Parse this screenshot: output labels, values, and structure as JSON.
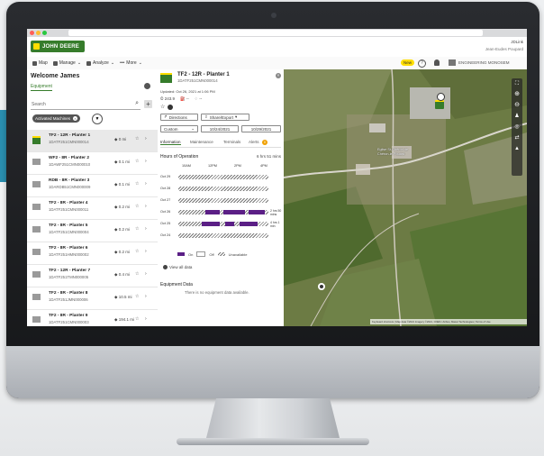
{
  "app": {
    "brand": "John Deere",
    "product": "JDLink",
    "user": "Jean-Eudes Poupard",
    "org": "ENGINEERING MONOSEM"
  },
  "nav": {
    "items": [
      "Map",
      "Manage",
      "Analyze",
      "More"
    ],
    "new_badge": "New"
  },
  "left_panel": {
    "welcome": "Welcome James",
    "tab": "Equipment",
    "search_placeholder": "Search",
    "filter_chip": "Activated Machines",
    "machines": [
      {
        "name": "TF2 - 12R - Planter 1",
        "id": "1DATF251CMN000014",
        "distance": "0 mi",
        "selected": true,
        "color": "green"
      },
      {
        "name": "WF2 - 8R - Planter 2",
        "id": "1DAWF251CMN000010",
        "distance": "0.1 mi",
        "selected": false,
        "color": "gray"
      },
      {
        "name": "RDB - 8R - Planter 3",
        "id": "1DARDB51CMN000009",
        "distance": "0.1 mi",
        "selected": false,
        "color": "gray"
      },
      {
        "name": "TF2 - 8R - Planter 4",
        "id": "1DATF251CMN000011",
        "distance": "0.2 mi",
        "selected": false,
        "color": "gray"
      },
      {
        "name": "TF2 - 8R - Planter 5",
        "id": "1DATF251CMN000004",
        "distance": "0.2 mi",
        "selected": false,
        "color": "gray"
      },
      {
        "name": "TF2 - 8R - Planter 6",
        "id": "1DATF251HMN000002",
        "distance": "0.2 mi",
        "selected": false,
        "color": "gray"
      },
      {
        "name": "TF2 - 12R - Planter 7",
        "id": "1DATF251TMN000005",
        "distance": "0.4 mi",
        "selected": false,
        "color": "gray"
      },
      {
        "name": "TF2 - 8R - Planter 8",
        "id": "1DATF251JMN000006",
        "distance": "10.5 mi",
        "selected": false,
        "color": "gray"
      },
      {
        "name": "TF2 - 8R - Planter 9",
        "id": "1DATF251CMN000003",
        "distance": "194.1 mi",
        "selected": false,
        "color": "gray"
      }
    ]
  },
  "detail": {
    "title": "TF2 - 12R - Planter 1",
    "serial": "1DATF251CMN000014",
    "updated": "Updated: Oct 26, 2021 at 1:06 PM",
    "hours": "243.9",
    "fuel": "--",
    "def": "--",
    "directions": "Directions",
    "share_export": "Share/Export",
    "range_select": "Custom",
    "date_from": "10/24/2021",
    "date_to": "10/29/2021",
    "tabs": [
      "Information",
      "Maintenance",
      "Terminals",
      "Alerts"
    ],
    "alerts_count": "0",
    "hours_title": "Hours of Operation",
    "hours_total": "6 hrs 51 mins",
    "time_axis": [
      "10AM",
      "12PM",
      "2PM",
      "4PM"
    ],
    "days": [
      {
        "label": "Oct 29",
        "note": ""
      },
      {
        "label": "Oct 28",
        "note": ""
      },
      {
        "label": "Oct 27",
        "note": ""
      },
      {
        "label": "Oct 26",
        "note": "2 hrs 50 mins"
      },
      {
        "label": "Oct 25",
        "note": "4 hrs 1 min"
      },
      {
        "label": "Oct 24",
        "note": ""
      }
    ],
    "legend": {
      "on": "On",
      "off": "Off",
      "unavailable": "Unavailable"
    },
    "view_all": "View all data",
    "equipment_data_title": "Equipment Data",
    "equipment_data_empty": "There is no equipment data available."
  },
  "map": {
    "labels": [
      "Eglise St-Chéron de",
      "Chéron-le-Pouard"
    ],
    "attribution": "Keyboard shortcuts | Map data ©2021 Imagery ©2021, CNES / Airbus, Maxar Technologies | Terms of Use"
  },
  "colors": {
    "jd_green": "#367c2b",
    "jd_yellow": "#ffde00",
    "on_purple": "#5b1f86"
  }
}
